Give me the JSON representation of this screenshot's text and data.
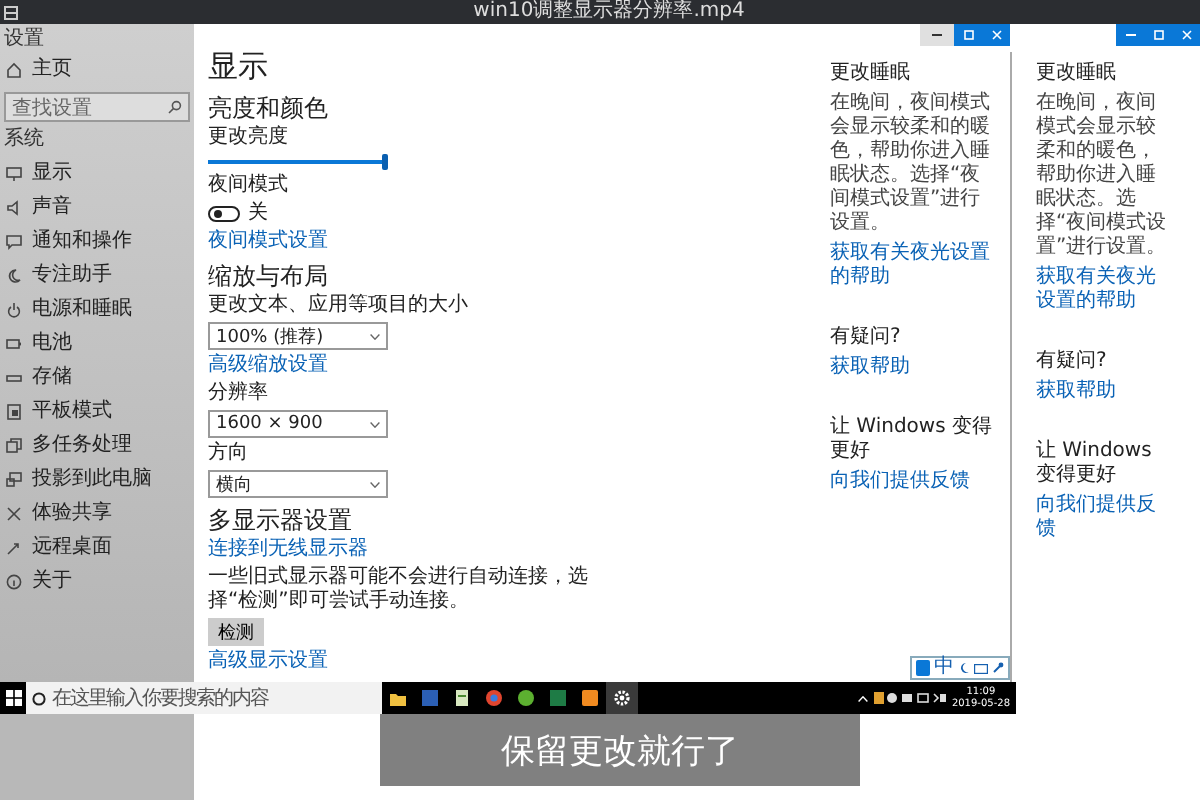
{
  "player": {
    "title": "win10调整显示器分辨率.mp4"
  },
  "sidebar": {
    "title": "设置",
    "home": "主页",
    "search": {
      "placeholder": "查找设置"
    },
    "section": "系统",
    "items": [
      {
        "label": "显示"
      },
      {
        "label": "声音"
      },
      {
        "label": "通知和操作"
      },
      {
        "label": "专注助手"
      },
      {
        "label": "电源和睡眠"
      },
      {
        "label": "电池"
      },
      {
        "label": "存储"
      },
      {
        "label": "平板模式"
      },
      {
        "label": "多任务处理"
      },
      {
        "label": "投影到此电脑"
      },
      {
        "label": "体验共享"
      },
      {
        "label": "远程桌面"
      },
      {
        "label": "关于"
      }
    ]
  },
  "page": {
    "title": "显示",
    "items": [
      {
        "kind": "heading",
        "text": "亮度和颜色"
      },
      {
        "kind": "label",
        "text": "更改亮度"
      },
      {
        "kind": "slider",
        "level": 1
      },
      {
        "kind": "label",
        "text": "夜间模式"
      },
      {
        "kind": "toggle",
        "on": false,
        "text": "关"
      },
      {
        "kind": "link",
        "text": "夜间模式设置"
      },
      {
        "kind": "heading",
        "text": "缩放与布局"
      },
      {
        "kind": "label",
        "text": "更改文本、应用等项目的大小"
      },
      {
        "kind": "dropdown",
        "value": "100% (推荐)"
      },
      {
        "kind": "link",
        "text": "高级缩放设置"
      },
      {
        "kind": "label",
        "text": "分辨率"
      },
      {
        "kind": "dropdown",
        "value": "1600 × 900"
      },
      {
        "kind": "label",
        "text": "方向"
      },
      {
        "kind": "dropdown",
        "value": "横向"
      },
      {
        "kind": "heading",
        "text": "多显示器设置"
      },
      {
        "kind": "link",
        "text": "连接到无线显示器"
      },
      {
        "kind": "text",
        "text": "一些旧式显示器可能不会进行自动连接，选择“检测”即可尝试手动连接。"
      },
      {
        "kind": "button",
        "text": "检测"
      },
      {
        "kind": "link",
        "text": "高级显示设置"
      }
    ]
  },
  "help_panels": [
    {
      "sections": [
        {
          "heading": "更改睡眠",
          "text": "在晚间，夜间模式会显示较柔和的暖色，帮助你进入睡眠状态。选择“夜间模式设置”进行设置。",
          "link": "获取有关夜光设置的帮助"
        },
        {
          "heading": "有疑问?",
          "link": "获取帮助"
        },
        {
          "heading": "让 Windows 变得更好",
          "link": "向我们提供反馈"
        }
      ]
    },
    {
      "sections": [
        {
          "heading": "更改睡眠",
          "text": "在晚间，夜间模式会显示较柔和的暖色，帮助你进入睡眠状态。选择“夜间模式设置”进行设置。",
          "link": "获取有关夜光设置的帮助"
        },
        {
          "heading": "有疑问?",
          "link": "获取帮助"
        },
        {
          "heading": "让 Windows 变得更好",
          "link": "向我们提供反馈"
        }
      ]
    }
  ],
  "input_bar": {
    "mode": "中"
  },
  "taskbar": {
    "search": {
      "placeholder": "在这里输入你要搜索的内容"
    },
    "apps": [
      {
        "kind": "folder",
        "selected": false
      },
      {
        "kind": "word",
        "selected": false
      },
      {
        "kind": "notepad",
        "selected": false
      },
      {
        "kind": "browser",
        "selected": false
      },
      {
        "kind": "green",
        "selected": false
      },
      {
        "kind": "excel",
        "selected": false
      },
      {
        "kind": "orange",
        "selected": false
      },
      {
        "kind": "settings",
        "selected": true
      }
    ],
    "clock": {
      "time": "11:09",
      "date": "2019-05-28"
    }
  },
  "caption": "保留更改就行了"
}
